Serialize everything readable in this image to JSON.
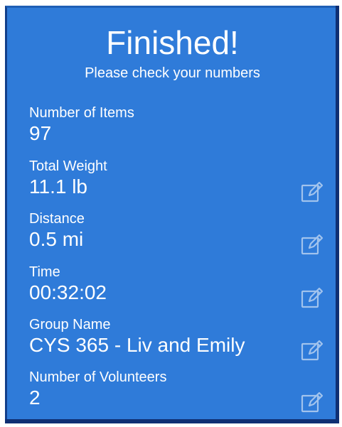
{
  "header": {
    "title": "Finished!",
    "subtitle": "Please check your numbers"
  },
  "fields": [
    {
      "label": "Number of Items",
      "value": "97",
      "editable": false
    },
    {
      "label": "Total Weight",
      "value": "11.1 lb",
      "editable": true,
      "icon": "edit-icon"
    },
    {
      "label": "Distance",
      "value": "0.5 mi",
      "editable": true,
      "icon": "edit-icon"
    },
    {
      "label": "Time",
      "value": "00:32:02",
      "editable": true,
      "icon": "edit-icon"
    },
    {
      "label": "Group Name",
      "value": "CYS 365 - Liv and Emily",
      "editable": true,
      "icon": "edit-icon"
    },
    {
      "label": "Number of Volunteers",
      "value": "2",
      "editable": true,
      "icon": "edit-icon"
    }
  ],
  "colors": {
    "panel_background": "#2f7bd9",
    "text": "#ffffff",
    "edit_icon": "#ffffff"
  }
}
